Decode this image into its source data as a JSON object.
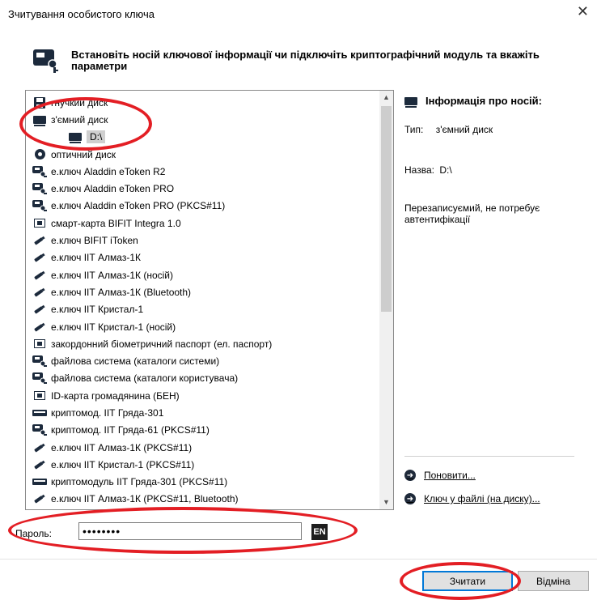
{
  "window": {
    "title": "Зчитування особистого ключа"
  },
  "header": {
    "text": "Встановіть носій ключової інформації чи підключіть криптографічний модуль та вкажіть параметри"
  },
  "devices": [
    {
      "label": "гнучкий диск",
      "icon": "floppy-disk-icon",
      "level": 0
    },
    {
      "label": "з'ємний диск",
      "icon": "hard-drive-icon",
      "level": 0
    },
    {
      "label": "D:\\",
      "icon": "hard-drive-icon",
      "level": 1,
      "selected": true
    },
    {
      "label": "оптичний диск",
      "icon": "optical-disc-icon",
      "level": 0
    },
    {
      "label": "е.ключ Aladdin eToken R2",
      "icon": "token-key-icon",
      "level": 0
    },
    {
      "label": "е.ключ Aladdin eToken PRO",
      "icon": "token-key-icon",
      "level": 0
    },
    {
      "label": "е.ключ Aladdin eToken PRO (PKCS#11)",
      "icon": "token-key-icon",
      "level": 0
    },
    {
      "label": "смарт-карта BIFIT Integra 1.0",
      "icon": "smart-card-icon",
      "level": 0
    },
    {
      "label": "е.ключ BIFIT iToken",
      "icon": "usb-key-icon",
      "level": 0
    },
    {
      "label": "е.ключ ІІТ Алмаз-1К",
      "icon": "usb-key-icon",
      "level": 0
    },
    {
      "label": "е.ключ ІІТ Алмаз-1К (носій)",
      "icon": "usb-key-icon",
      "level": 0
    },
    {
      "label": "е.ключ ІІТ Алмаз-1К (Bluetooth)",
      "icon": "usb-key-icon",
      "level": 0
    },
    {
      "label": "е.ключ ІІТ Кристал-1",
      "icon": "usb-key-icon",
      "level": 0
    },
    {
      "label": "е.ключ ІІТ Кристал-1 (носій)",
      "icon": "usb-key-icon",
      "level": 0
    },
    {
      "label": "закордонний біометричний паспорт (ел. паспорт)",
      "icon": "smart-card-icon",
      "level": 0
    },
    {
      "label": "файлова система (каталоги системи)",
      "icon": "token-key-icon",
      "level": 0
    },
    {
      "label": "файлова система (каталоги користувача)",
      "icon": "token-key-icon",
      "level": 0
    },
    {
      "label": "ID-карта громадянина (БЕН)",
      "icon": "smart-card-icon",
      "level": 0
    },
    {
      "label": "криптомод. ІІТ Гряда-301",
      "icon": "crypto-module-icon",
      "level": 0
    },
    {
      "label": "криптомод. ІІТ Гряда-61 (PKCS#11)",
      "icon": "token-key-icon",
      "level": 0
    },
    {
      "label": "е.ключ ІІТ Алмаз-1К (PKCS#11)",
      "icon": "usb-key-icon",
      "level": 0
    },
    {
      "label": "е.ключ ІІТ Кристал-1 (PKCS#11)",
      "icon": "usb-key-icon",
      "level": 0
    },
    {
      "label": "криптомодуль ІІТ Гряда-301 (PKCS#11)",
      "icon": "crypto-module-icon",
      "level": 0
    },
    {
      "label": "е.ключ ІІТ Алмаз-1К (PKCS#11, Bluetooth)",
      "icon": "usb-key-icon",
      "level": 0
    }
  ],
  "info": {
    "title": "Інформація про носій:",
    "type_label": "Тип:",
    "type_value": "з'ємний диск",
    "name_label": "Назва:",
    "name_value": "D:\\",
    "description": "Перезаписуємий, не потребує автентифікації",
    "refresh_link": "Поновити...",
    "file_key_link": "Ключ у файлі (на диску)..."
  },
  "password": {
    "label": "Пароль:",
    "value": "••••••••",
    "lang": "EN"
  },
  "buttons": {
    "read": "Зчитати",
    "cancel": "Відміна"
  },
  "colors": {
    "annotation": "#e31e24",
    "accent": "#0078d7",
    "icon": "#1c2a3c"
  }
}
